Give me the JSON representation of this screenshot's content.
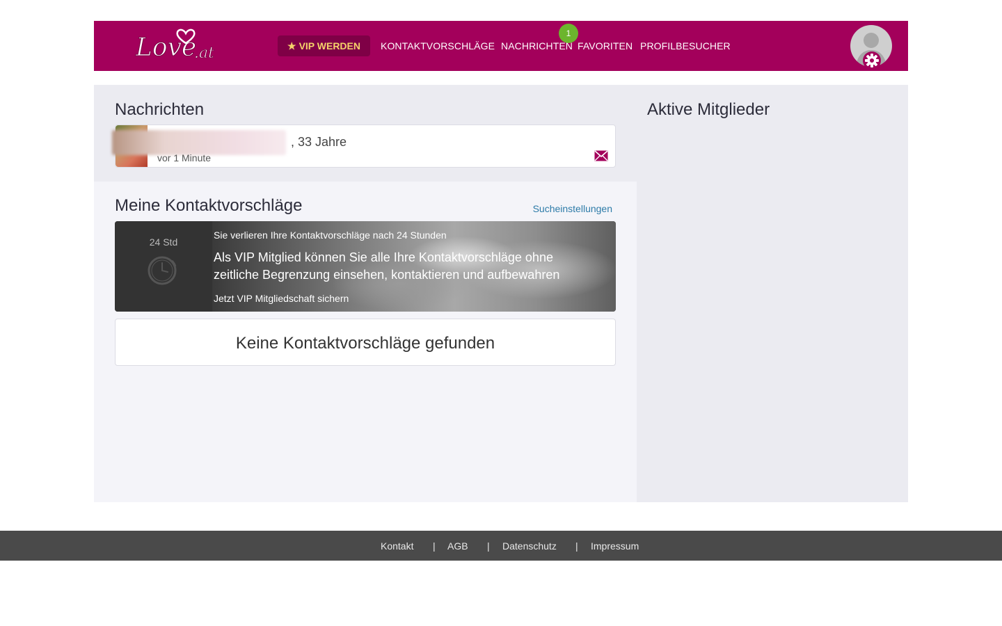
{
  "header": {
    "logo_text": "Love.at",
    "vip_button": "VIP WERDEN",
    "nav": [
      {
        "label": "KONTAKTVORSCHLÄGE"
      },
      {
        "label": "NACHRICHTEN",
        "badge": "1"
      },
      {
        "label": "FAVORITEN"
      },
      {
        "label": "PROFILBESUCHER"
      }
    ],
    "brand_color": "#a3005b"
  },
  "messages": {
    "title": "Nachrichten",
    "items": [
      {
        "name_suffix": ", 33 Jahre",
        "time": "vor 1 Minute",
        "icon": "envelope-icon"
      }
    ]
  },
  "active_members": {
    "title": "Aktive Mitglieder"
  },
  "suggestions": {
    "title": "Meine Kontaktvorschläge",
    "search_settings_link": "Sucheinstellungen",
    "promo": {
      "timer": "24 Std",
      "line1": "Sie verlieren Ihre Kontaktvorschläge nach 24 Stunden",
      "main": "Als VIP Mitglied können Sie alle Ihre Kontaktvorschläge ohne zeitliche Begrenzung einsehen, kontaktieren und aufbewahren",
      "cta": "Jetzt VIP Mitgliedschaft sichern"
    },
    "empty_message": "Keine Kontaktvorschläge gefunden"
  },
  "footer": {
    "links": [
      "Kontakt",
      "AGB",
      "Datenschutz",
      "Impressum"
    ],
    "separator": "|"
  }
}
